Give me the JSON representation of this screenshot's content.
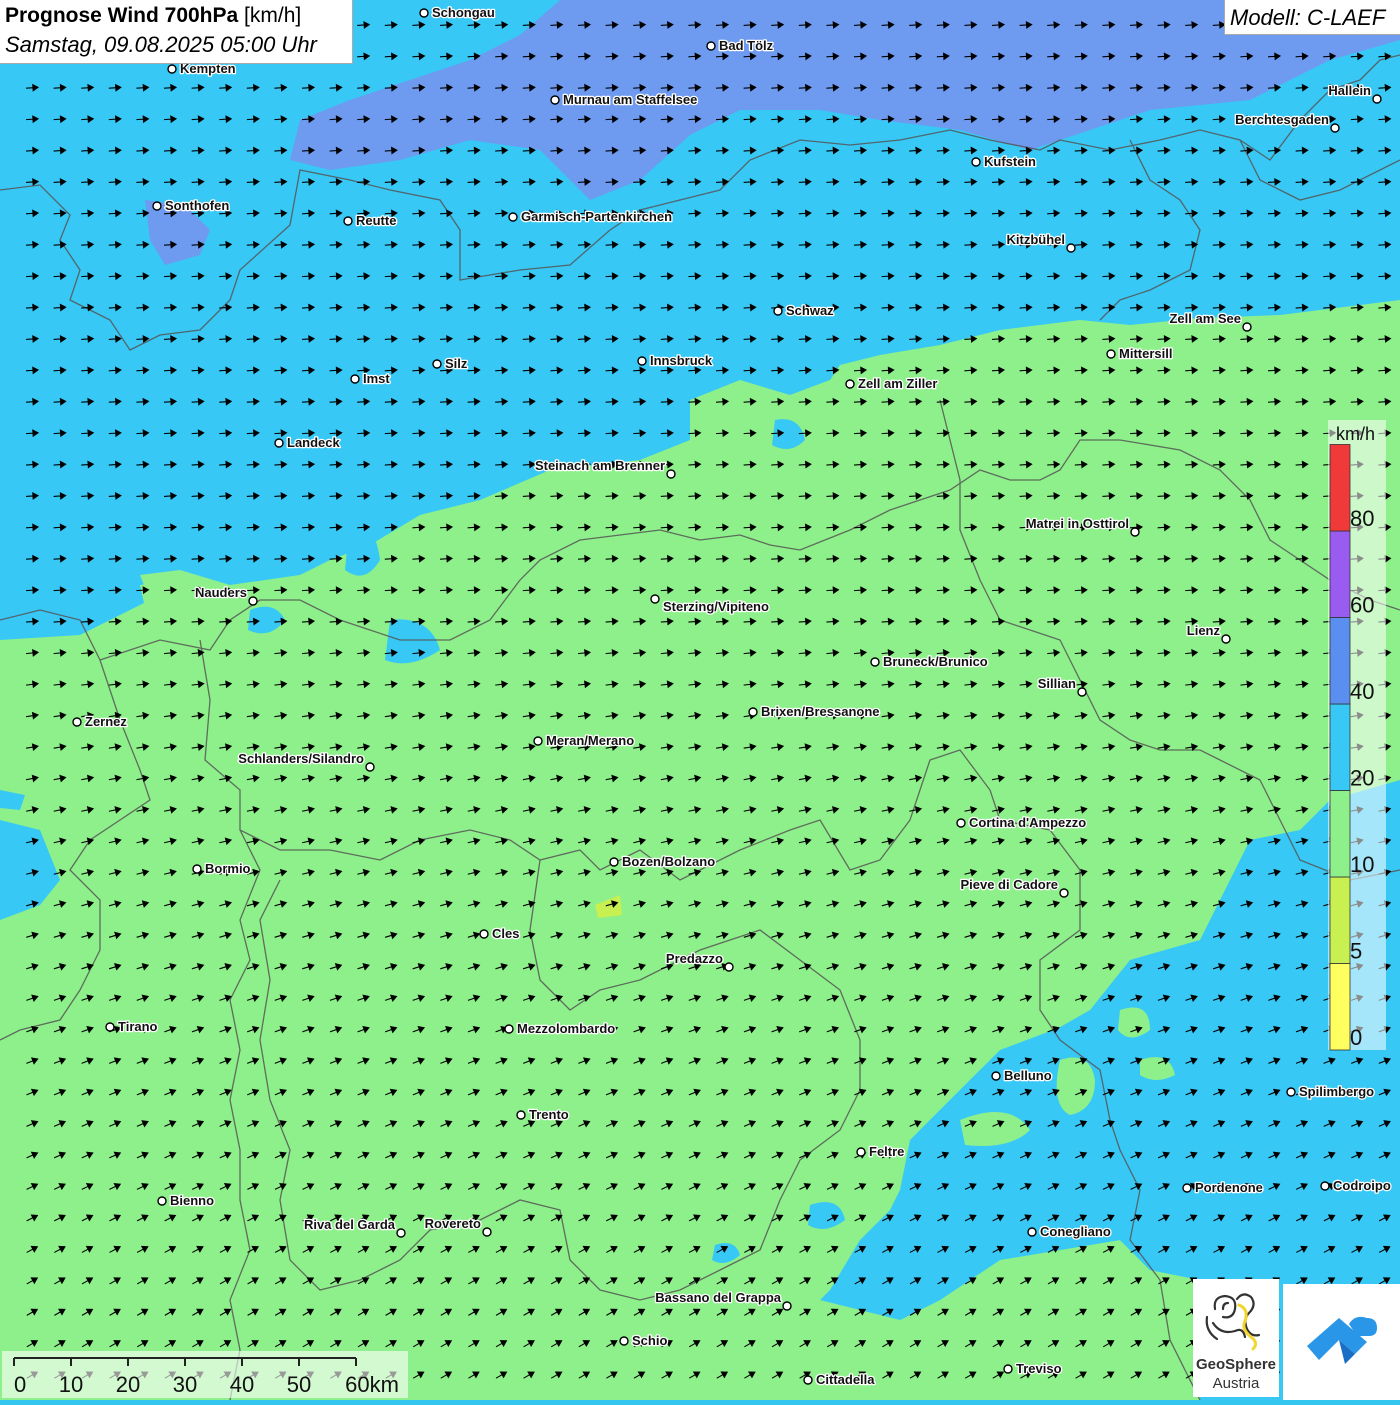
{
  "title": {
    "bold": "Prognose Wind 700hPa",
    "unit": "[km/h]",
    "datetime": "Samstag, 09.08.2025 05:00 Uhr"
  },
  "model": "Modell: C-LAEF",
  "legend": {
    "unit": "km/h",
    "ticks": [
      "0",
      "5",
      "10",
      "20",
      "40",
      "60",
      "80"
    ],
    "bands": [
      {
        "from": 0,
        "to": 5,
        "color": "#ffff60"
      },
      {
        "from": 5,
        "to": 10,
        "color": "#c8f050"
      },
      {
        "from": 10,
        "to": 20,
        "color": "#8ef08a"
      },
      {
        "from": 20,
        "to": 40,
        "color": "#38c8f5"
      },
      {
        "from": 40,
        "to": 60,
        "color": "#5a8ff0"
      },
      {
        "from": 60,
        "to": 80,
        "color": "#9a5cf0"
      },
      {
        "from": 80,
        "to": 100,
        "color": "#f03a3a"
      }
    ]
  },
  "colors": {
    "field_slow": "#8ef08a",
    "field_mid": "#38c8f5",
    "field_fast": "#6e9af0",
    "borders": "#555555",
    "arrows": "#000000"
  },
  "wind_direction": "from west-southwest, arrows pointing east to east-northeast",
  "scale_bar": {
    "labels": [
      "0",
      "10",
      "20",
      "30",
      "40",
      "50",
      "60km"
    ]
  },
  "logos": {
    "geosphere_line1": "GeoSphere",
    "geosphere_line2": "Austria",
    "second_logo_icon": "cloud-arrow-logo-icon"
  },
  "cities": [
    {
      "name": "Schongau"
    },
    {
      "name": "Bad Tölz"
    },
    {
      "name": "Kempten"
    },
    {
      "name": "Murnau am Staffelsee"
    },
    {
      "name": "Hallein"
    },
    {
      "name": "Berchtesgaden"
    },
    {
      "name": "Kufstein"
    },
    {
      "name": "Sonthofen"
    },
    {
      "name": "Reutte"
    },
    {
      "name": "Garmisch-Partenkirchen"
    },
    {
      "name": "Kitzbühel"
    },
    {
      "name": "Schwaz"
    },
    {
      "name": "Zell am See"
    },
    {
      "name": "Mittersill"
    },
    {
      "name": "Innsbruck"
    },
    {
      "name": "Silz"
    },
    {
      "name": "Imst"
    },
    {
      "name": "Zell am Ziller"
    },
    {
      "name": "Landeck"
    },
    {
      "name": "Steinach am Brenner"
    },
    {
      "name": "Matrei in Osttirol"
    },
    {
      "name": "Nauders"
    },
    {
      "name": "Sterzing/Vipiteno"
    },
    {
      "name": "Lienz"
    },
    {
      "name": "Bruneck/Brunico"
    },
    {
      "name": "Sillian"
    },
    {
      "name": "Zernez"
    },
    {
      "name": "Brixen/Bressanone"
    },
    {
      "name": "Meran/Merano"
    },
    {
      "name": "Schlanders/Silandro"
    },
    {
      "name": "Cortina d'Ampezzo"
    },
    {
      "name": "Bozen/Bolzano"
    },
    {
      "name": "Bormio"
    },
    {
      "name": "Pieve di Cadore"
    },
    {
      "name": "Cles"
    },
    {
      "name": "Predazzo"
    },
    {
      "name": "Tirano"
    },
    {
      "name": "Mezzolombardo"
    },
    {
      "name": "Belluno"
    },
    {
      "name": "Spilimbergo"
    },
    {
      "name": "Trento"
    },
    {
      "name": "Feltre"
    },
    {
      "name": "Pordenone"
    },
    {
      "name": "Codroipo"
    },
    {
      "name": "Bienno"
    },
    {
      "name": "Riva del Garda"
    },
    {
      "name": "Rovereto"
    },
    {
      "name": "Conegliano"
    },
    {
      "name": "Bassano del Grappa"
    },
    {
      "name": "Schio"
    },
    {
      "name": "Treviso"
    },
    {
      "name": "Cittadella"
    }
  ]
}
